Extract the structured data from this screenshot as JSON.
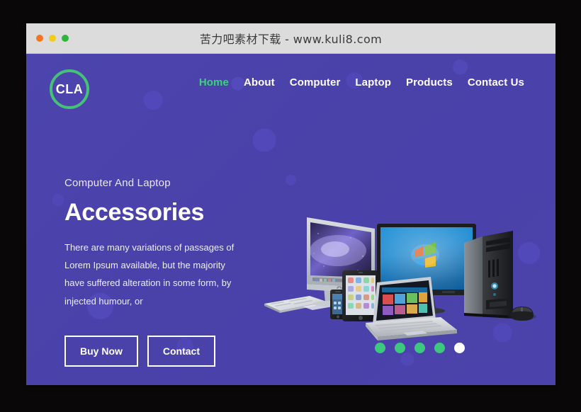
{
  "window": {
    "title": "苦力吧素材下载 - www.kuli8.com",
    "traffic_lights": [
      {
        "name": "close",
        "color": "#f4751f"
      },
      {
        "name": "minimize",
        "color": "#f2cb1c"
      },
      {
        "name": "zoom",
        "color": "#2bb739"
      }
    ]
  },
  "theme": {
    "background": "#4b43aa",
    "accent_green": "#3ad37c",
    "logo_ring": "#45c178",
    "text_light": "#ffffff"
  },
  "nav": {
    "logo_text": "CLA",
    "links": [
      {
        "label": "Home",
        "active": true
      },
      {
        "label": "About",
        "active": false
      },
      {
        "label": "Computer",
        "active": false
      },
      {
        "label": "Laptop",
        "active": false
      },
      {
        "label": "Products",
        "active": false
      },
      {
        "label": "Contact Us",
        "active": false
      }
    ]
  },
  "hero": {
    "eyebrow": "Computer And Laptop",
    "title": "Accessories",
    "paragraph": "There are many variations of passages of Lorem Ipsum available, but the majority have suffered alteration in some form, by injected humour, or",
    "buttons": [
      {
        "label": "Buy Now"
      },
      {
        "label": "Contact"
      }
    ],
    "image_alt": "computer-devices-montage",
    "devices": [
      "imac",
      "windows-monitor",
      "desktop-tower",
      "tablet",
      "smartphone",
      "laptop",
      "keyboard",
      "mouse"
    ]
  },
  "carousel": {
    "dots": [
      {
        "active": false
      },
      {
        "active": false
      },
      {
        "active": false
      },
      {
        "active": false
      },
      {
        "active": true
      }
    ]
  }
}
